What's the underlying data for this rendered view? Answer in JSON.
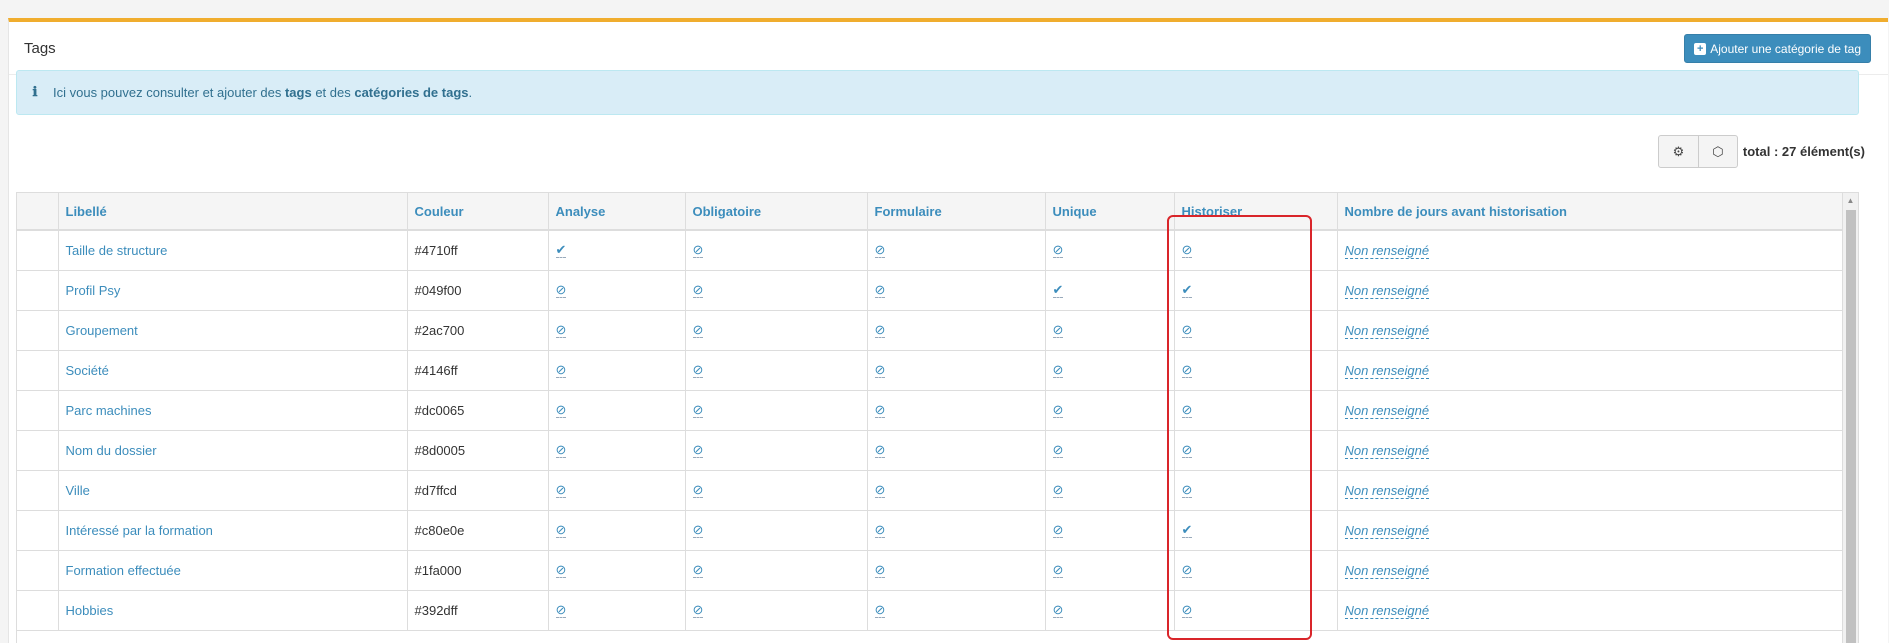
{
  "panel": {
    "title": "Tags",
    "add_button_label": "Ajouter une catégorie de tag",
    "add_button_icon": "plus-square-icon"
  },
  "info": {
    "icon": "ℹ",
    "text_before": "Ici vous pouvez consulter et ajouter des ",
    "bold1": "tags",
    "text_middle": " et des ",
    "bold2": "catégories de tags",
    "text_after": "."
  },
  "toolbar": {
    "settings_icon": "⚙",
    "cube_icon": "⬡",
    "total": "total : 27 élément(s)"
  },
  "table": {
    "columns": [
      "",
      "Libellé",
      "Couleur",
      "Analyse",
      "Obligatoire",
      "Formulaire",
      "Unique",
      "Historiser",
      "Nombre de jours avant historisation"
    ],
    "rows": [
      {
        "label": "Taille de structure",
        "color": "#4710ff",
        "analyse": "✔",
        "obligatoire": "⊘",
        "formulaire": "⊘",
        "unique": "⊘",
        "historiser": "⊘",
        "days": "Non renseigné"
      },
      {
        "label": "Profil Psy",
        "color": "#049f00",
        "analyse": "⊘",
        "obligatoire": "⊘",
        "formulaire": "⊘",
        "unique": "✔",
        "historiser": "✔",
        "days": "Non renseigné"
      },
      {
        "label": "Groupement",
        "color": "#2ac700",
        "analyse": "⊘",
        "obligatoire": "⊘",
        "formulaire": "⊘",
        "unique": "⊘",
        "historiser": "⊘",
        "days": "Non renseigné"
      },
      {
        "label": "Société",
        "color": "#4146ff",
        "analyse": "⊘",
        "obligatoire": "⊘",
        "formulaire": "⊘",
        "unique": "⊘",
        "historiser": "⊘",
        "days": "Non renseigné"
      },
      {
        "label": "Parc machines",
        "color": "#dc0065",
        "analyse": "⊘",
        "obligatoire": "⊘",
        "formulaire": "⊘",
        "unique": "⊘",
        "historiser": "⊘",
        "days": "Non renseigné"
      },
      {
        "label": "Nom du dossier",
        "color": "#8d0005",
        "analyse": "⊘",
        "obligatoire": "⊘",
        "formulaire": "⊘",
        "unique": "⊘",
        "historiser": "⊘",
        "days": "Non renseigné"
      },
      {
        "label": "Ville",
        "color": "#d7ffcd",
        "analyse": "⊘",
        "obligatoire": "⊘",
        "formulaire": "⊘",
        "unique": "⊘",
        "historiser": "⊘",
        "days": "Non renseigné"
      },
      {
        "label": "Intéressé par la formation",
        "color": "#c80e0e",
        "analyse": "⊘",
        "obligatoire": "⊘",
        "formulaire": "⊘",
        "unique": "⊘",
        "historiser": "✔",
        "days": "Non renseigné"
      },
      {
        "label": "Formation effectuée",
        "color": "#1fa000",
        "analyse": "⊘",
        "obligatoire": "⊘",
        "formulaire": "⊘",
        "unique": "⊘",
        "historiser": "⊘",
        "days": "Non renseigné"
      },
      {
        "label": "Hobbies",
        "color": "#392dff",
        "analyse": "⊘",
        "obligatoire": "⊘",
        "formulaire": "⊘",
        "unique": "⊘",
        "historiser": "⊘",
        "days": "Non renseigné"
      }
    ]
  },
  "colors": {
    "accent": "#f0ad2e",
    "primary": "#3c8dbc",
    "callout_bg": "#d9edf7",
    "highlight": "#d9252a"
  }
}
